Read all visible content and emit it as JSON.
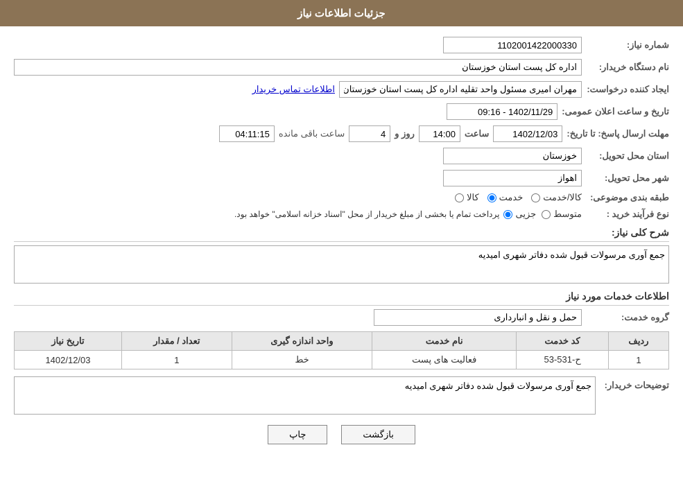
{
  "header": {
    "title": "جزئیات اطلاعات نیاز"
  },
  "fields": {
    "need_number_label": "شماره نیاز:",
    "need_number_value": "1102001422000330",
    "buyer_org_label": "نام دستگاه خریدار:",
    "buyer_org_value": "اداره کل پست استان خوزستان",
    "requester_label": "ایجاد کننده درخواست:",
    "requester_value": "مهران امیری مسئول واحد تقلیه اداره کل پست استان خوزستان",
    "requester_contact": "اطلاعات تماس خریدار",
    "announce_datetime_label": "تاریخ و ساعت اعلان عمومی:",
    "announce_datetime_value": "1402/11/29 - 09:16",
    "deadline_label": "مهلت ارسال پاسخ: تا تاریخ:",
    "deadline_date": "1402/12/03",
    "deadline_time_label": "ساعت",
    "deadline_time": "14:00",
    "deadline_days_label": "روز و",
    "deadline_days": "4",
    "remaining_label": "ساعت باقی مانده",
    "remaining_time": "04:11:15",
    "province_label": "استان محل تحویل:",
    "province_value": "خوزستان",
    "city_label": "شهر محل تحویل:",
    "city_value": "اهواز",
    "category_label": "طبقه بندی موضوعی:",
    "category_options": [
      {
        "label": "کالا",
        "value": "kala"
      },
      {
        "label": "خدمت",
        "value": "khadamat"
      },
      {
        "label": "کالا/خدمت",
        "value": "kala_khadamat"
      }
    ],
    "category_selected": "khadamat",
    "purchase_type_label": "نوع فرآیند خرید :",
    "purchase_type_options": [
      {
        "label": "جزیی",
        "value": "jozei"
      },
      {
        "label": "متوسط",
        "value": "motavaset"
      }
    ],
    "purchase_type_selected": "jozei",
    "purchase_note": "پرداخت تمام یا بخشی از مبلغ خریدار از محل \"اسناد خزانه اسلامی\" خواهد بود.",
    "need_summary_label": "شرح کلی نیاز:",
    "need_summary_value": "جمع آوری مرسولات قبول شده دفاتر شهری امیدیه",
    "services_title": "اطلاعات خدمات مورد نیاز",
    "service_group_label": "گروه خدمت:",
    "service_group_value": "حمل و نقل و انبارداری",
    "table": {
      "headers": [
        "ردیف",
        "کد خدمت",
        "نام خدمت",
        "واحد اندازه گیری",
        "تعداد / مقدار",
        "تاریخ نیاز"
      ],
      "rows": [
        {
          "row": "1",
          "code": "ح-531-53",
          "name": "فعالیت های پست",
          "unit": "خط",
          "quantity": "1",
          "date": "1402/12/03"
        }
      ]
    },
    "buyer_desc_label": "توضیحات خریدار:",
    "buyer_desc_value": "جمع آوری مرسولات قبول شده دفاتر شهری امیدیه"
  },
  "buttons": {
    "print": "چاپ",
    "back": "بازگشت"
  }
}
